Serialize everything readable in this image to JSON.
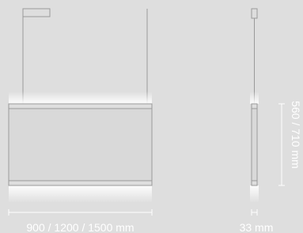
{
  "dimensions": {
    "width_label": "900 / 1200 / 1500 mm",
    "depth_label": "33 mm",
    "height_label": "560 / 710 mm"
  },
  "colors": {
    "background": "#dedede",
    "stroke": "#9a9a9a",
    "dimension_line": "#ffffff",
    "panel_fill": "#d9d9d9",
    "glow": "#ffffff"
  }
}
